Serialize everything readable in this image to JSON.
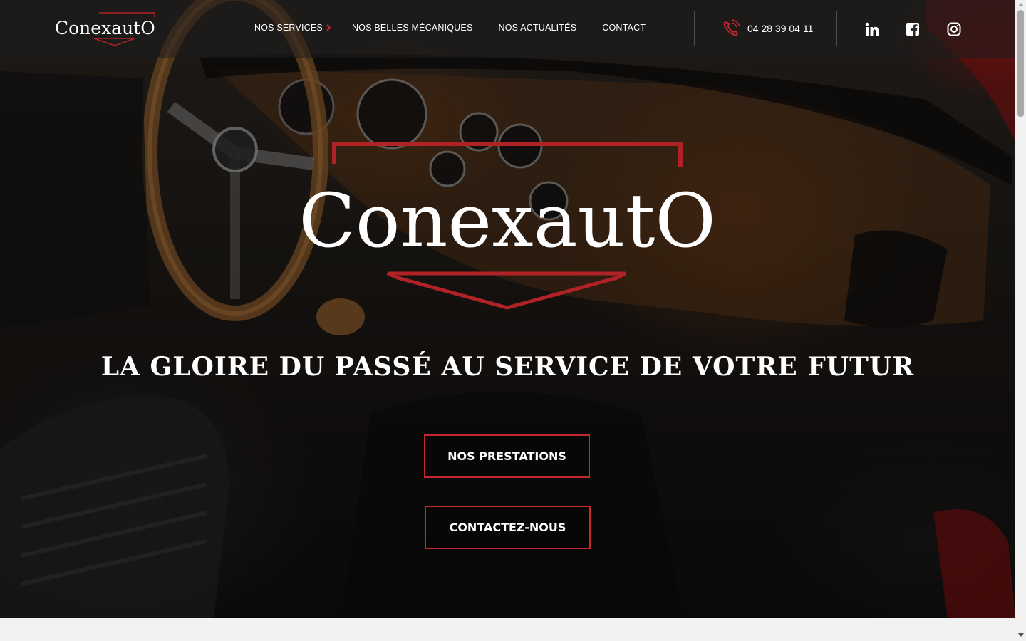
{
  "brand": {
    "name": "ConexautO",
    "accent_color": "#c5282d"
  },
  "nav": {
    "items": [
      {
        "label": "NOS SERVICES",
        "has_dropdown": true,
        "dropdown_icon": "chevron-right-icon"
      },
      {
        "label": "NOS BELLES MÉCANIQUES"
      },
      {
        "label": "NOS ACTUALITÉS"
      },
      {
        "label": "CONTACT"
      }
    ]
  },
  "contact": {
    "phone": "04 28 39 04 11",
    "phone_icon": "phone-icon"
  },
  "social": [
    {
      "name": "linkedin-icon"
    },
    {
      "name": "facebook-icon"
    },
    {
      "name": "instagram-icon"
    }
  ],
  "hero": {
    "background": "car-dashboard-photo",
    "logo_text": "ConexautO",
    "tagline": "LA GLOIRE DU PASSÉ AU SERVICE DE VOTRE FUTUR",
    "buttons": [
      {
        "label": "NOS PRESTATIONS"
      },
      {
        "label": "CONTACTEZ-NOUS"
      }
    ]
  }
}
